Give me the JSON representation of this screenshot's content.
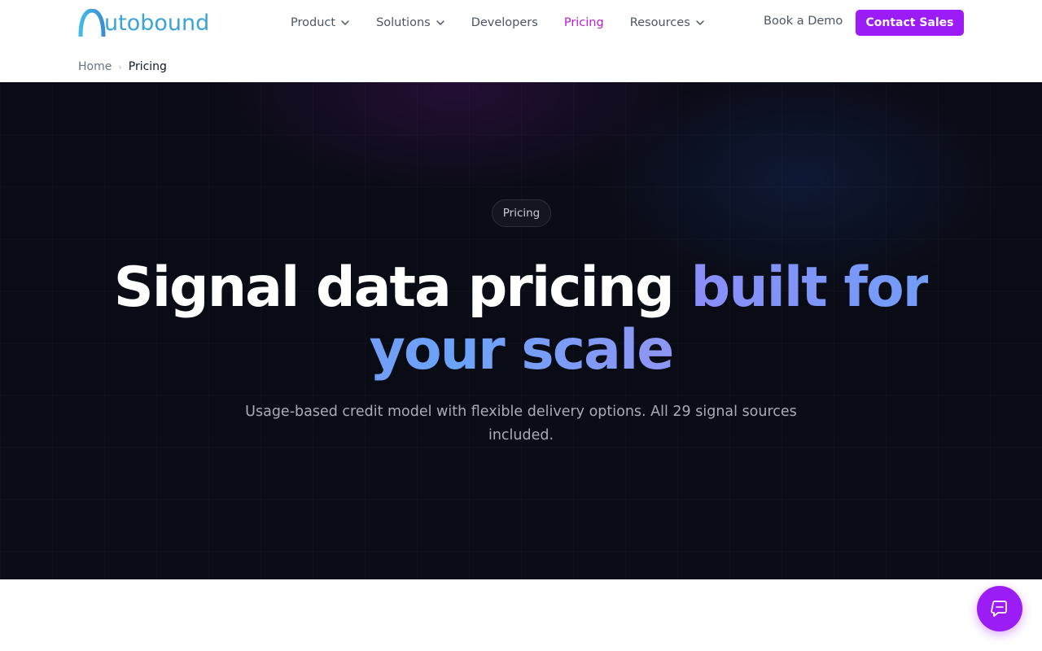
{
  "brand": {
    "logo_text": "utobound",
    "logo_color": "#3aa4d8"
  },
  "nav": {
    "items": [
      {
        "label": "Product",
        "has_dropdown": true,
        "active": false
      },
      {
        "label": "Solutions",
        "has_dropdown": true,
        "active": false
      },
      {
        "label": "Developers",
        "has_dropdown": false,
        "active": false
      },
      {
        "label": "Pricing",
        "has_dropdown": false,
        "active": true
      },
      {
        "label": "Resources",
        "has_dropdown": true,
        "active": false
      }
    ],
    "book_demo_label": "Book a Demo",
    "contact_sales_label": "Contact Sales"
  },
  "breadcrumb": {
    "home": "Home",
    "separator": "›",
    "current": "Pricing"
  },
  "hero": {
    "badge": "Pricing",
    "headline_plain": "Signal data pricing ",
    "headline_gradient": "built for your scale",
    "subtext": "Usage-based credit model with flexible delivery options. All 29 signal sources included."
  },
  "chat": {
    "icon": "chat-bubble-icon"
  },
  "colors": {
    "accent": "#9b1cf5",
    "active_nav": "#b91cd6",
    "hero_bg": "#0a0c15",
    "gradient_start": "#8b8df8",
    "gradient_end": "#6aa3f7"
  }
}
